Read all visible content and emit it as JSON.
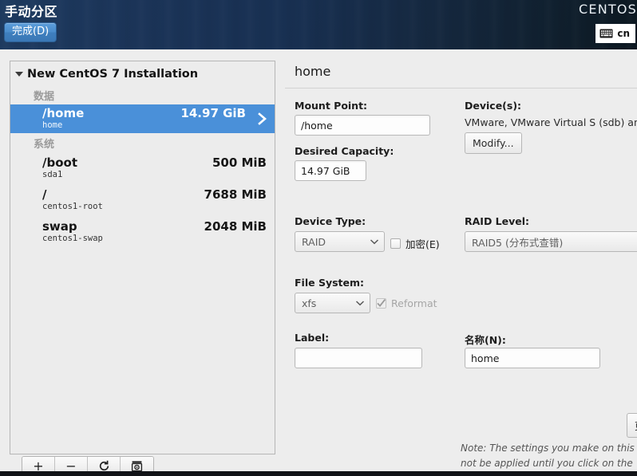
{
  "header": {
    "title": "手动分区",
    "done_button": "完成(D)",
    "distro": "CENTOS",
    "keyboard_icon": "keyboard-icon",
    "keyboard_layout": "cn"
  },
  "sidebar": {
    "root_label": "New CentOS 7 Installation",
    "expand_icon": "triangle-down-icon",
    "groups": [
      {
        "title": "数据",
        "items": [
          {
            "name": "/home",
            "sub": "home",
            "size": "14.97 GiB",
            "selected": true,
            "chevron": "chevron-right-icon"
          }
        ]
      },
      {
        "title": "系统",
        "items": [
          {
            "name": "/boot",
            "sub": "sda1",
            "size": "500 MiB",
            "selected": false
          },
          {
            "name": "/",
            "sub": "centos1-root",
            "size": "7688 MiB",
            "selected": false
          },
          {
            "name": "swap",
            "sub": "centos1-swap",
            "size": "2048 MiB",
            "selected": false
          }
        ]
      }
    ],
    "toolbar": [
      {
        "icon": "plus-icon",
        "glyph": "+"
      },
      {
        "icon": "minus-icon",
        "glyph": "−"
      },
      {
        "icon": "refresh-icon",
        "glyph": "⟳"
      },
      {
        "icon": "disk-info-icon",
        "glyph": "⊛"
      }
    ]
  },
  "details": {
    "title": "home",
    "mount_point_label": "Mount Point:",
    "mount_point_value": "/home",
    "desired_capacity_label": "Desired Capacity:",
    "desired_capacity_value": "14.97 GiB",
    "devices_label": "Device(s):",
    "devices_value": "VMware, VMware Virtual S (sdb) an",
    "modify_button": "Modify...",
    "device_type_label": "Device Type:",
    "device_type_value": "RAID",
    "encrypt_label": "加密(E)",
    "encrypt_checked": false,
    "raid_level_label": "RAID Level:",
    "raid_level_value": "RAID5 (分布式查错)",
    "file_system_label": "File System:",
    "file_system_value": "xfs",
    "reformat_label": "Reformat",
    "reformat_checked": true,
    "label_label": "Label:",
    "label_value": "",
    "name_label": "名称(N):",
    "name_value": "home",
    "update_settings_button": "更",
    "note_line1": "Note:  The settings you make on this",
    "note_line2": "not be applied until you click on the"
  },
  "colors": {
    "selection_blue": "#4a90d9",
    "header_dark": "#1b3458",
    "panel_bg": "#ededed"
  }
}
